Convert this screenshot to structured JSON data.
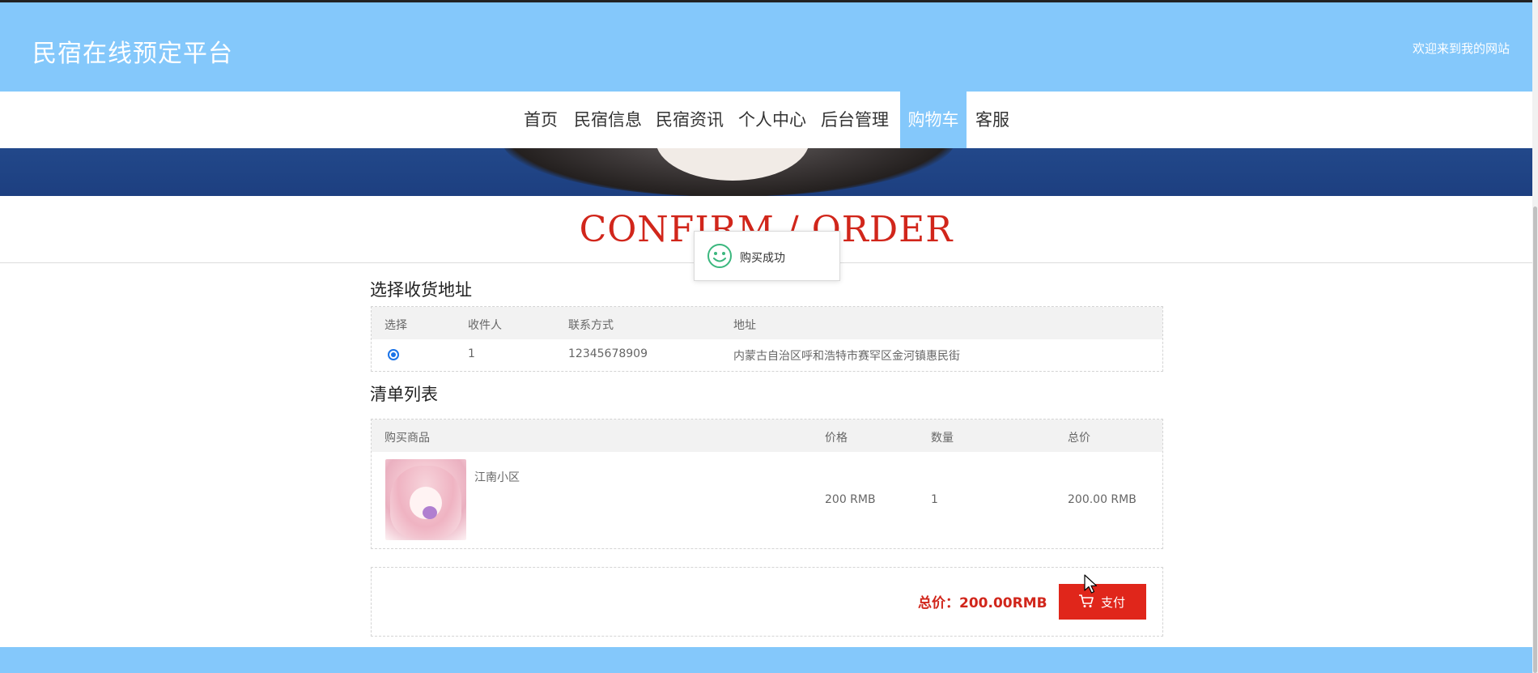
{
  "header": {
    "site_title": "民宿在线预定平台",
    "welcome": "欢迎来到我的网站"
  },
  "nav": {
    "items": [
      {
        "label": "首页"
      },
      {
        "label": "民宿信息"
      },
      {
        "label": "民宿资讯"
      },
      {
        "label": "个人中心"
      },
      {
        "label": "后台管理"
      },
      {
        "label": "购物车",
        "active": true
      },
      {
        "label": "客服"
      }
    ],
    "active_color": "#84c8fb"
  },
  "page": {
    "heading": "CONFIRM / ORDER"
  },
  "toast": {
    "message": "购买成功",
    "icon": "smile-icon"
  },
  "address_section": {
    "title": "选择收货地址",
    "columns": [
      "选择",
      "收件人",
      "联系方式",
      "地址"
    ],
    "rows": [
      {
        "selected": true,
        "recipient": "1",
        "phone": "12345678909",
        "address": "内蒙古自治区呼和浩特市赛罕区金河镇惠民街"
      }
    ]
  },
  "list_section": {
    "title": "清单列表",
    "columns": [
      "购买商品",
      "价格",
      "数量",
      "总价"
    ],
    "items": [
      {
        "name": "江南小区",
        "price": "200 RMB",
        "quantity": "1",
        "total": "200.00 RMB"
      }
    ]
  },
  "summary": {
    "total_label": "总价：200.00RMB",
    "pay_button": "支付",
    "accent_color": "#e0261b"
  }
}
